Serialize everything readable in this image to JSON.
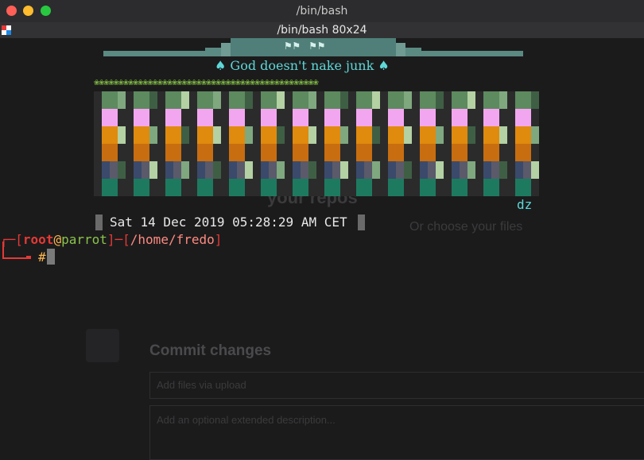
{
  "window": {
    "title": "/bin/bash",
    "tab_title": "/bin/bash 80x24"
  },
  "banner": {
    "logo_glyphs": "⚑⚑ ⚑⚑",
    "motto": "♠ God doesn't nake junk ♠",
    "flower_row": "❀❀❀❀❀❀❀❀❀❀❀❀❀❀❀❀❀❀❀❀❀❀❀❀❀❀❀❀❀❀❀❀❀❀❀❀❀❀❀❀❀❀❀❀❀❀",
    "row_colors": [
      "#5d8a5e",
      "#f3a6f0",
      "#e08a0e",
      "#c86d10",
      "#3b4a6b",
      "#1e7a5f"
    ],
    "tag": "dz"
  },
  "terminal": {
    "date_line": "Sat 14 Dec 2019 05:28:29 AM CET",
    "prompt": {
      "open": "┌─[",
      "user": "root",
      "at": "@",
      "host": "parrot",
      "sep": "]─[",
      "path": "/home/fredo",
      "close": "]",
      "symbol": "#"
    }
  },
  "background_window": {
    "heading_fragment": "your repos",
    "sub_fragment": "Or choose your files",
    "commit_title": "Commit changes",
    "commit_placeholder": "Add files via upload",
    "description_placeholder": "Add an optional extended description..."
  }
}
